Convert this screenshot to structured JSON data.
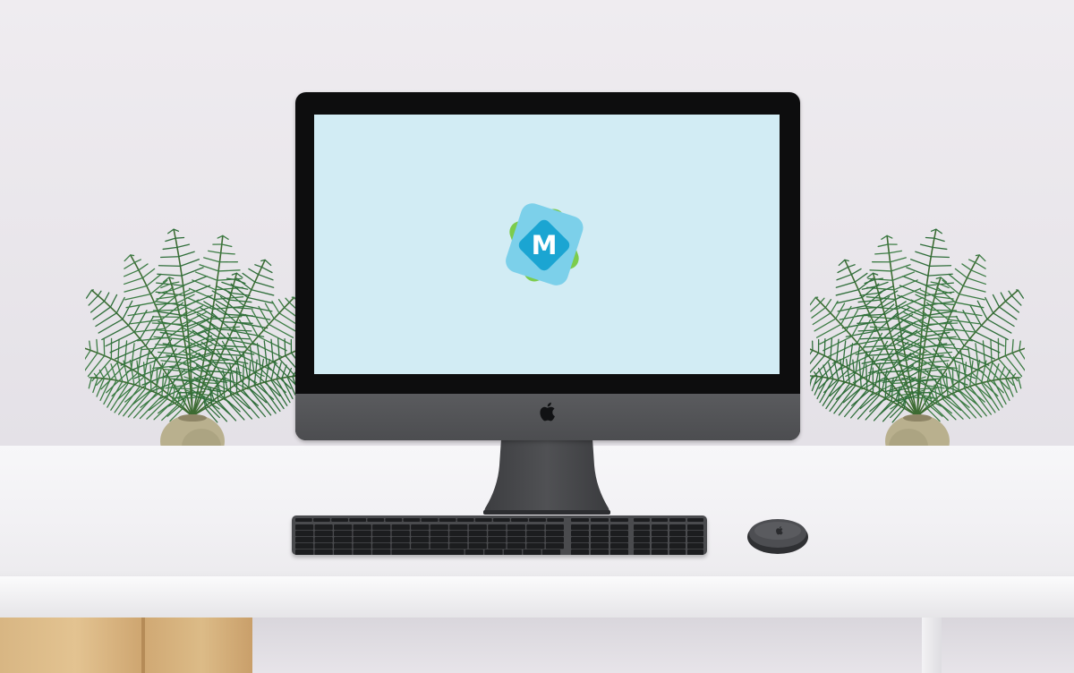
{
  "scene": {
    "description_tags": [
      "wall",
      "desk",
      "plant-left",
      "plant-right",
      "imac",
      "keyboard",
      "mouse"
    ]
  },
  "screen": {
    "logo_letter": "M",
    "background_color": "#d2ecf4"
  },
  "colors": {
    "logo_blue_light": "#7cd0ea",
    "logo_blue_dark": "#1ba5d2",
    "logo_green": "#7ccc4c",
    "device_gray": "#4a4b4e",
    "leaf_green": "#2f6e3a",
    "pot_beige": "#b9b08e"
  },
  "icons": {
    "apple": "apple-icon",
    "mouse_apple": "apple-icon"
  }
}
